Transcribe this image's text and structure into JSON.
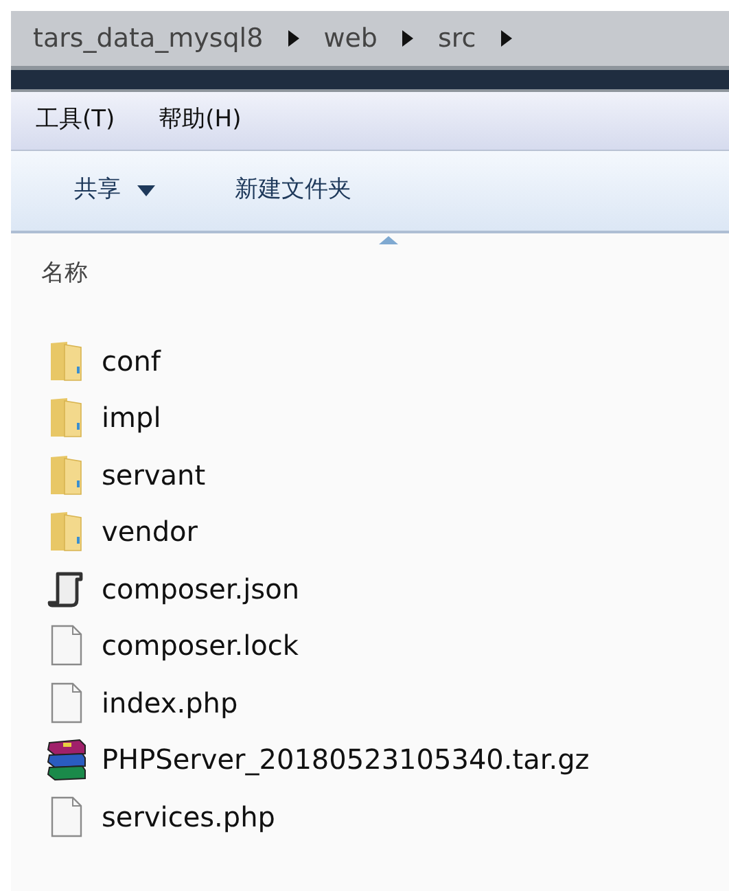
{
  "breadcrumb": [
    "tars_data_mysql8",
    "web",
    "src"
  ],
  "menu": [
    "工具(T)",
    "帮助(H)"
  ],
  "toolbar": [
    {
      "label": "共享",
      "dropdown": true
    },
    {
      "label": "新建文件夹",
      "dropdown": false
    }
  ],
  "column_header": {
    "label": "名称",
    "sorted": true
  },
  "files": [
    {
      "name": "conf",
      "kind": "folder"
    },
    {
      "name": "impl",
      "kind": "folder"
    },
    {
      "name": "servant",
      "kind": "folder"
    },
    {
      "name": "vendor",
      "kind": "folder"
    },
    {
      "name": "composer.json",
      "kind": "script"
    },
    {
      "name": "composer.lock",
      "kind": "file"
    },
    {
      "name": "index.php",
      "kind": "file"
    },
    {
      "name": "PHPServer_20180523105340.tar.gz",
      "kind": "archive"
    },
    {
      "name": "services.php",
      "kind": "file"
    }
  ]
}
